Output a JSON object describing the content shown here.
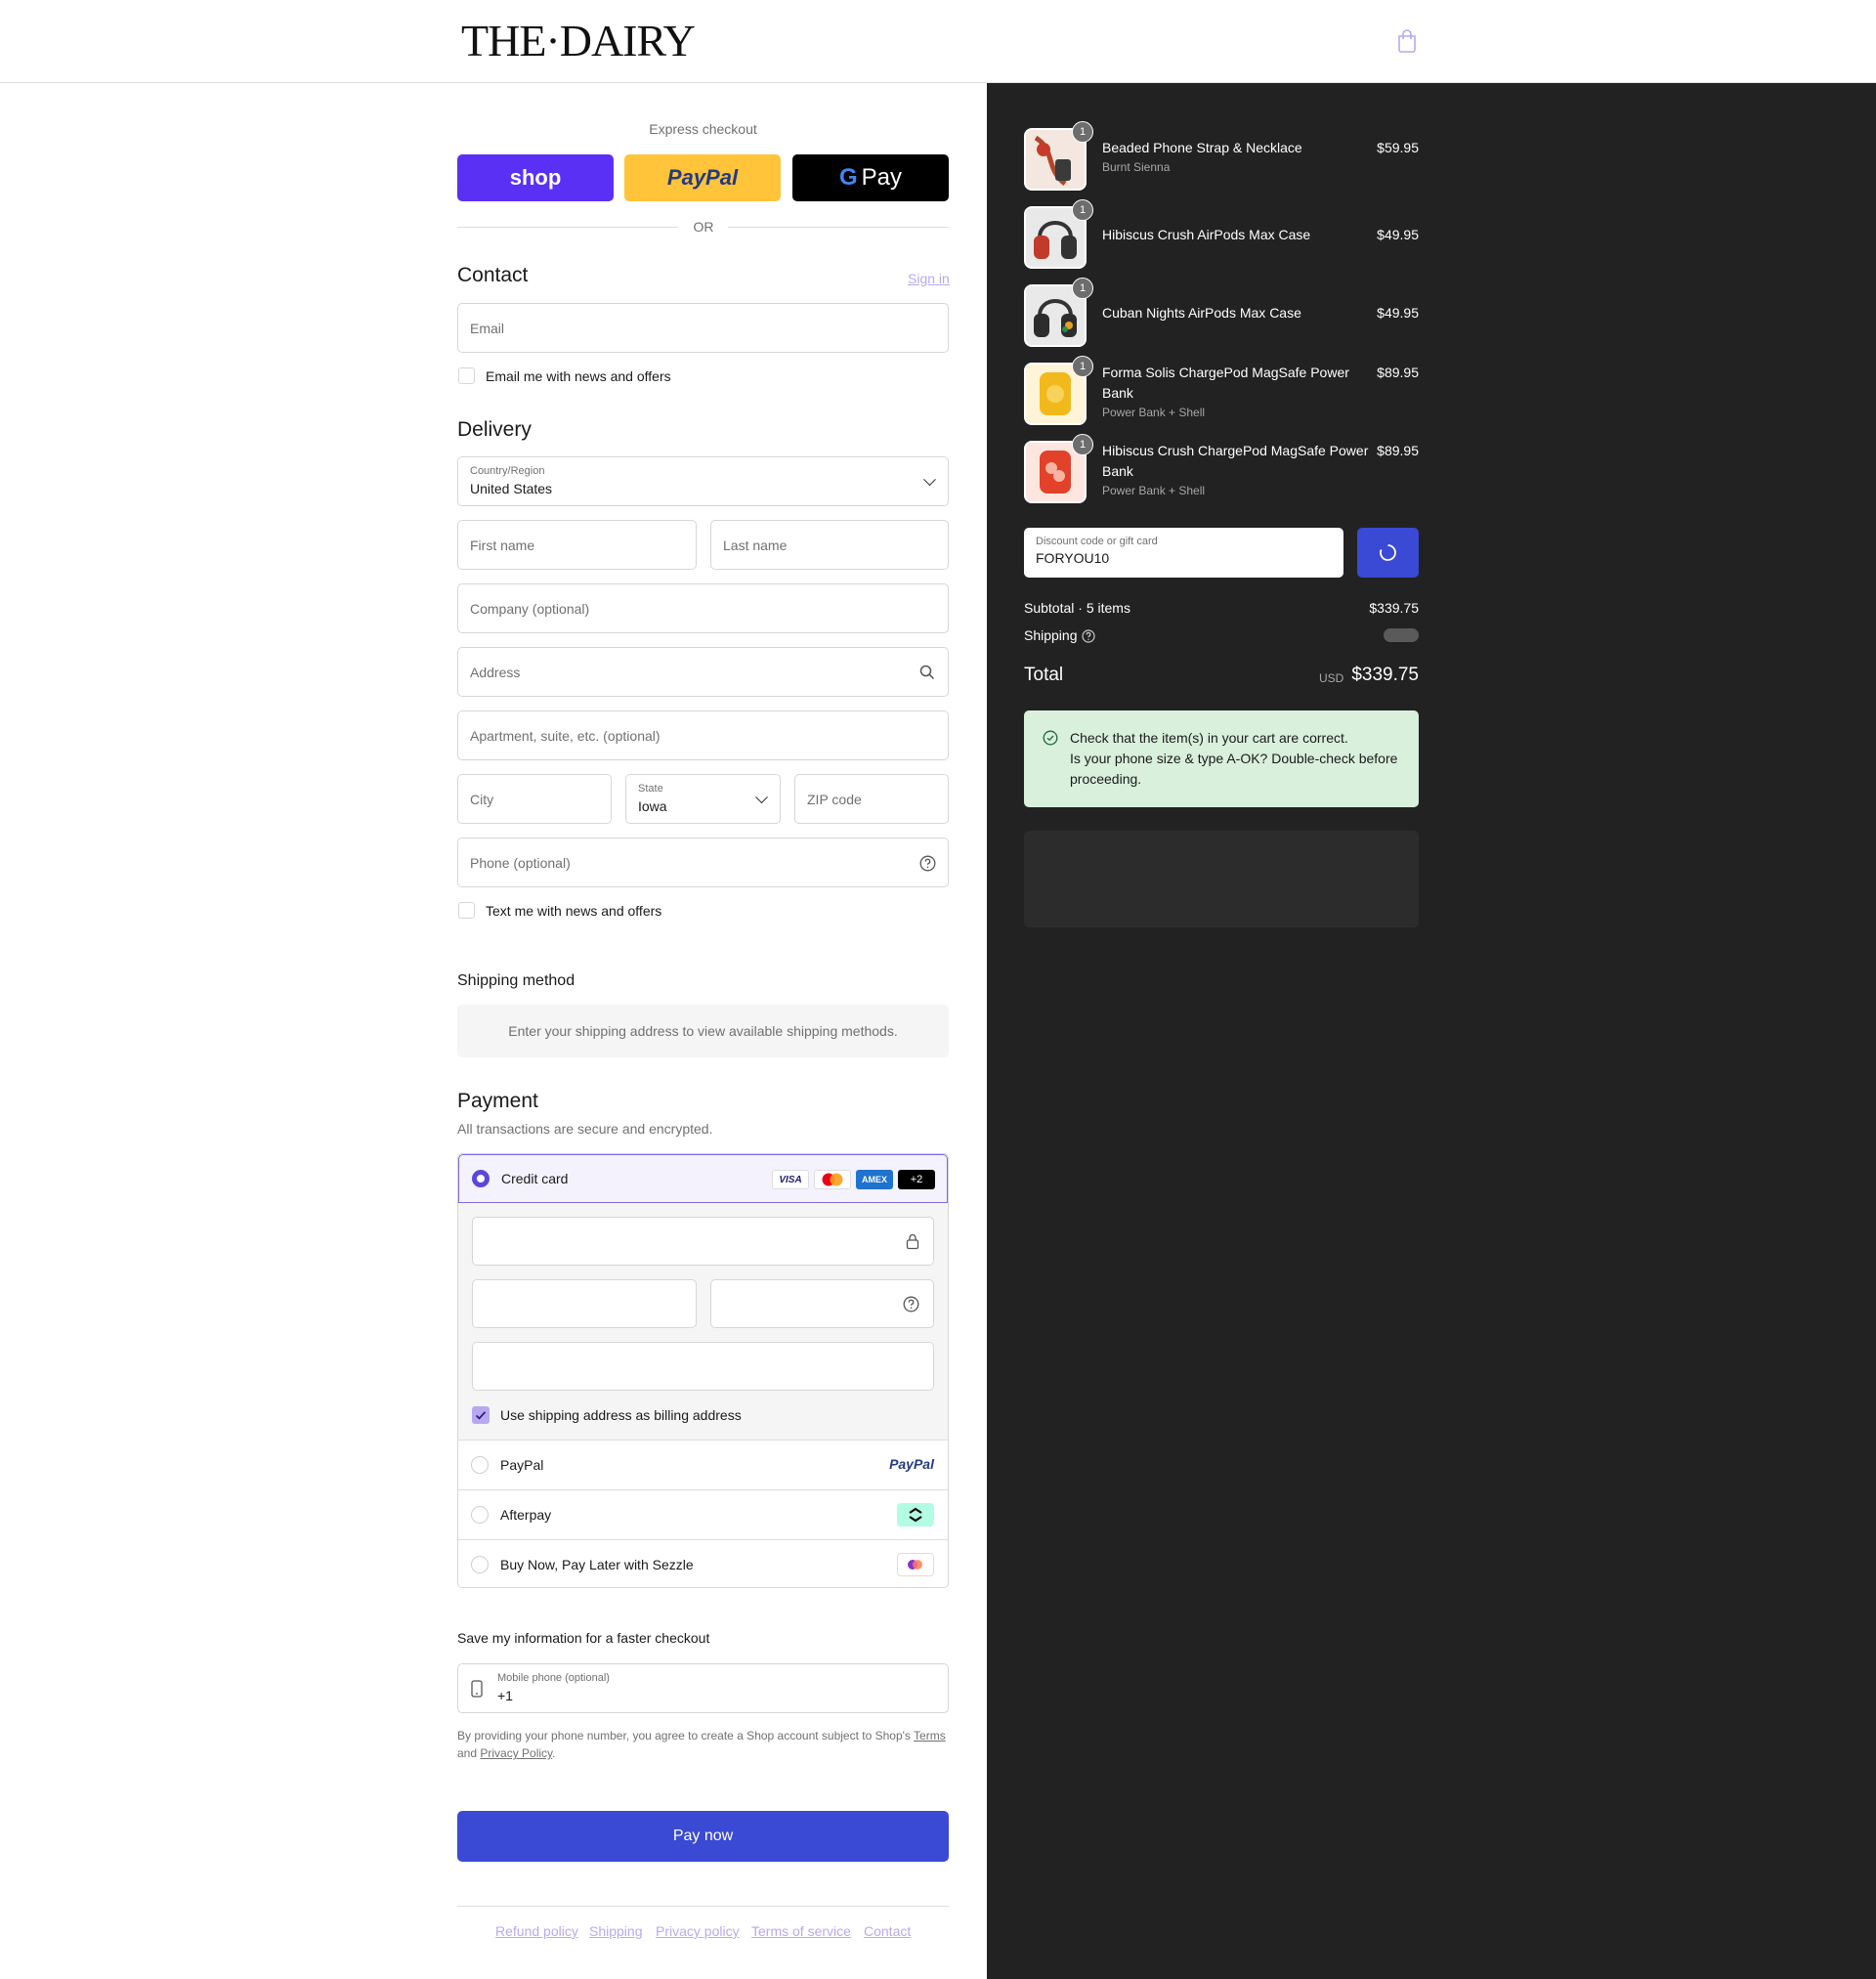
{
  "brand": {
    "logo": "THE·DAIRY"
  },
  "express": {
    "label": "Express checkout",
    "shop_label": "shop",
    "paypal_label": "PayPal",
    "gpay_g": "G",
    "gpay_label": "Pay",
    "or_label": "OR"
  },
  "contact": {
    "heading": "Contact",
    "sign_in": "Sign in",
    "email_placeholder": "Email",
    "news_label": "Email me with news and offers"
  },
  "delivery": {
    "heading": "Delivery",
    "country_label": "Country/Region",
    "country_value": "United States",
    "first_name": "First name",
    "last_name": "Last name",
    "company": "Company (optional)",
    "address": "Address",
    "apartment": "Apartment, suite, etc. (optional)",
    "city": "City",
    "state_label": "State",
    "state_value": "Iowa",
    "zip": "ZIP code",
    "phone": "Phone (optional)",
    "text_label": "Text me with news and offers"
  },
  "shipping_method": {
    "heading": "Shipping method",
    "message": "Enter your shipping address to view available shipping methods."
  },
  "payment": {
    "heading": "Payment",
    "subtitle": "All transactions are secure and encrypted.",
    "credit_card_label": "Credit card",
    "cards": [
      "VISA",
      "",
      "AMEX",
      "+2"
    ],
    "billing_label": "Use shipping address as billing address",
    "paypal_label": "PayPal",
    "paypal_logo": "PayPal",
    "afterpay_label": "Afterpay",
    "sezzle_label": "Buy Now, Pay Later with Sezzle"
  },
  "save_info": {
    "heading": "Save my information for a faster checkout",
    "mobile_label": "Mobile phone (optional)",
    "mobile_value": "+1",
    "disclaimer_prefix": "By providing your phone number, you agree to create a Shop account subject to Shop's ",
    "terms": "Terms",
    "and": "and ",
    "privacy": "Privacy Policy",
    "period": "."
  },
  "pay_now_label": "Pay now",
  "footer_links": [
    "Refund policy",
    "Shipping",
    "Privacy policy",
    "Terms of service",
    "Contact"
  ],
  "cart": {
    "items": [
      {
        "name": "Beaded Phone Strap & Necklace",
        "variant": "Burnt Sienna",
        "price": "$59.95",
        "qty": "1"
      },
      {
        "name": "Hibiscus Crush AirPods Max Case",
        "variant": "",
        "price": "$49.95",
        "qty": "1"
      },
      {
        "name": "Cuban Nights AirPods Max Case",
        "variant": "",
        "price": "$49.95",
        "qty": "1"
      },
      {
        "name": "Forma Solis ChargePod MagSafe Power Bank",
        "variant": "Power Bank + Shell",
        "price": "$89.95",
        "qty": "1"
      },
      {
        "name": "Hibiscus Crush ChargePod MagSafe Power Bank",
        "variant": "Power Bank + Shell",
        "price": "$89.95",
        "qty": "1"
      }
    ],
    "discount_label": "Discount code or gift card",
    "discount_value": "FORYOU10",
    "subtotal_label": "Subtotal · 5 items",
    "subtotal_value": "$339.75",
    "shipping_label": "Shipping",
    "total_label": "Total",
    "currency": "USD",
    "total_value": "$339.75",
    "notice_line1": "Check that the item(s) in your cart are correct.",
    "notice_line2": "Is your phone size & type A-OK? Double-check before proceeding."
  },
  "colors": {
    "accent": "#3a4ad4",
    "shop_purple": "#5a31f4",
    "paypal_yellow": "#ffc439",
    "notice_green": "#d9f0dc",
    "summary_bg": "#222222"
  }
}
